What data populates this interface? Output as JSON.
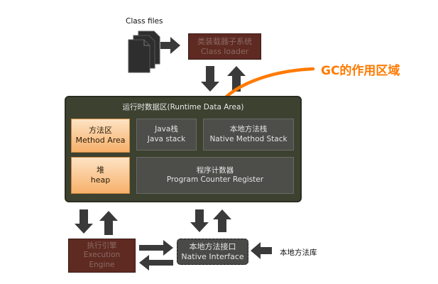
{
  "class_files_label": "Class files",
  "class_loader": {
    "cn": "类装载器子系统",
    "en": "Class loader"
  },
  "runtime_area_title": "运行时数据区(Runtime Data Area)",
  "method_area": {
    "cn": "方法区",
    "en": "Method Area"
  },
  "java_stack": {
    "cn": "Java栈",
    "en": "Java stack"
  },
  "native_method_stack": {
    "cn": "本地方法栈",
    "en": "Native Method Stack"
  },
  "heap": {
    "cn": "堆",
    "en": "heap"
  },
  "program_counter": {
    "cn": "程序计数器",
    "en": "Program Counter Register"
  },
  "execution_engine": {
    "cn": "执行引擎",
    "en1": "Execution",
    "en2": "Engine"
  },
  "native_interface": {
    "cn": "本地方法接口",
    "en": "Native Interface"
  },
  "native_library_label": "本地方法库",
  "gc_annotation": "GC的作用区域",
  "colors": {
    "maroon": "#5e2a22",
    "runtime_bg": "#3d4130",
    "highlight_orange": "#ff7a00",
    "grey_box": "#4d4d4a",
    "arrow": "#3a3a3a"
  }
}
